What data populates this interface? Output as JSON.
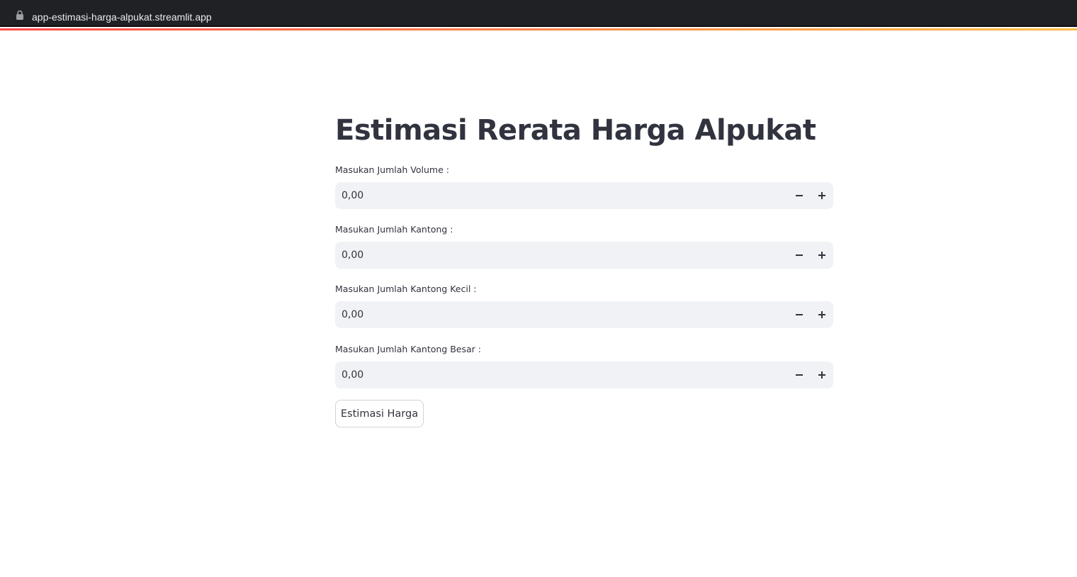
{
  "browser": {
    "url": "app-estimasi-harga-alpukat.streamlit.app",
    "lock_icon": "lock-icon"
  },
  "app": {
    "title": "Estimasi Rerata Harga Alpukat",
    "fields": [
      {
        "label": "Masukan Jumlah Volume :",
        "value": "0,00"
      },
      {
        "label": "Masukan Jumlah Kantong :",
        "value": "0,00"
      },
      {
        "label": "Masukan Jumlah Kantong Kecil :",
        "value": "0,00"
      },
      {
        "label": "Masukan Jumlah Kantong Besar :",
        "value": "0,00"
      }
    ],
    "submit_label": "Estimasi Harga",
    "icons": {
      "decrement": "minus-icon",
      "increment": "plus-icon"
    },
    "colors": {
      "text": "#31333f",
      "input_bg": "#f0f2f6",
      "decoration_start": "#ff4b4b",
      "decoration_end": "#ffbd45"
    }
  }
}
